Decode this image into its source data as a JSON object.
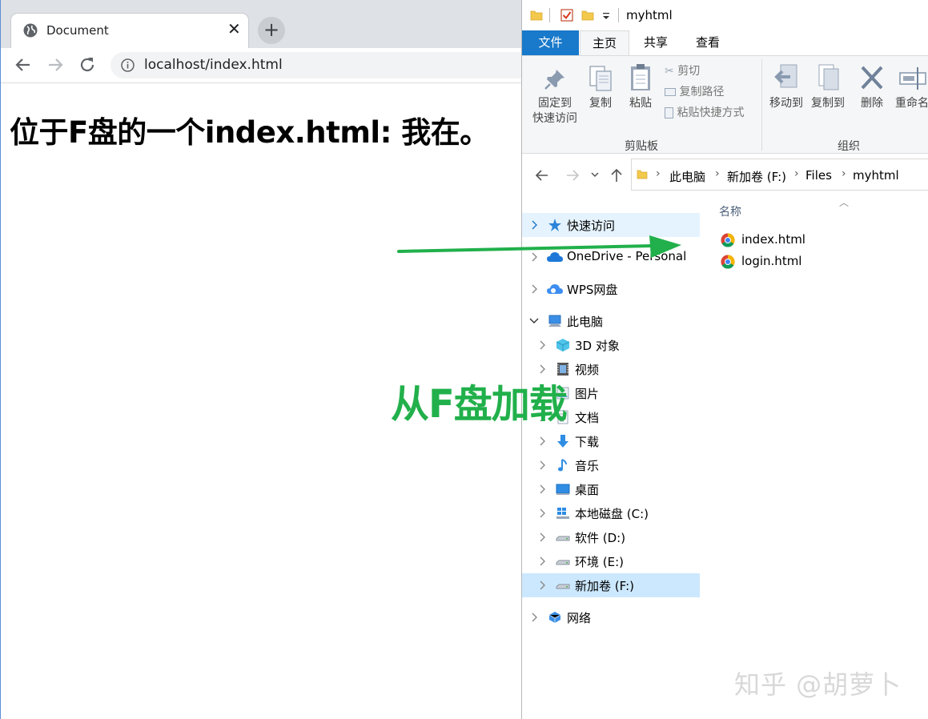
{
  "browser": {
    "tab_title": "Document",
    "tab_close": "✕",
    "new_tab": "+",
    "url": "localhost/index.html",
    "page_heading": "位于F盘的一个index.html: 我在。"
  },
  "explorer": {
    "window_title": "myhtml",
    "ribbon_tabs": {
      "file": "文件",
      "home": "主页",
      "share": "共享",
      "view": "查看"
    },
    "ribbon": {
      "pin_line1": "固定到",
      "pin_line2": "快速访问",
      "copy": "复制",
      "paste": "粘贴",
      "cut": "剪切",
      "copy_path": "复制路径",
      "paste_shortcut": "粘贴快捷方式",
      "clipboard_group": "剪贴板",
      "move_to": "移动到",
      "copy_to": "复制到",
      "delete": "删除",
      "rename": "重命名",
      "organize_group": "组织"
    },
    "breadcrumb": [
      "此电脑",
      "新加卷 (F:)",
      "Files",
      "myhtml"
    ],
    "nav_items": [
      {
        "label": "快速访问",
        "icon": "star-pin-icon"
      },
      {
        "label": "OneDrive - Personal",
        "icon": "onedrive-cloud-icon"
      },
      {
        "label": "WPS网盘",
        "icon": "wps-cloud-icon"
      },
      {
        "label": "此电脑",
        "icon": "computer-icon"
      },
      {
        "label": "3D 对象",
        "icon": "3d-objects-icon"
      },
      {
        "label": "视频",
        "icon": "video-icon"
      },
      {
        "label": "图片",
        "icon": "pictures-icon"
      },
      {
        "label": "文档",
        "icon": "documents-icon"
      },
      {
        "label": "下载",
        "icon": "download-icon"
      },
      {
        "label": "音乐",
        "icon": "music-icon"
      },
      {
        "label": "桌面",
        "icon": "desktop-icon"
      },
      {
        "label": "本地磁盘 (C:)",
        "icon": "windows-drive-icon"
      },
      {
        "label": "软件 (D:)",
        "icon": "drive-icon"
      },
      {
        "label": "环境 (E:)",
        "icon": "drive-icon"
      },
      {
        "label": "新加卷 (F:)",
        "icon": "drive-icon"
      },
      {
        "label": "网络",
        "icon": "network-icon"
      }
    ],
    "column_name": "名称",
    "files": [
      {
        "name": "index.html",
        "icon": "chrome-file-icon"
      },
      {
        "name": "login.html",
        "icon": "chrome-file-icon"
      }
    ]
  },
  "annotation": {
    "text": "从F盘加载",
    "color": "#21b04b"
  },
  "watermark": "知乎 @胡萝卜",
  "colors": {
    "file_tab_blue": "#1979ca",
    "selection_blue": "#cce8ff",
    "annotation_green": "#21b04b"
  }
}
